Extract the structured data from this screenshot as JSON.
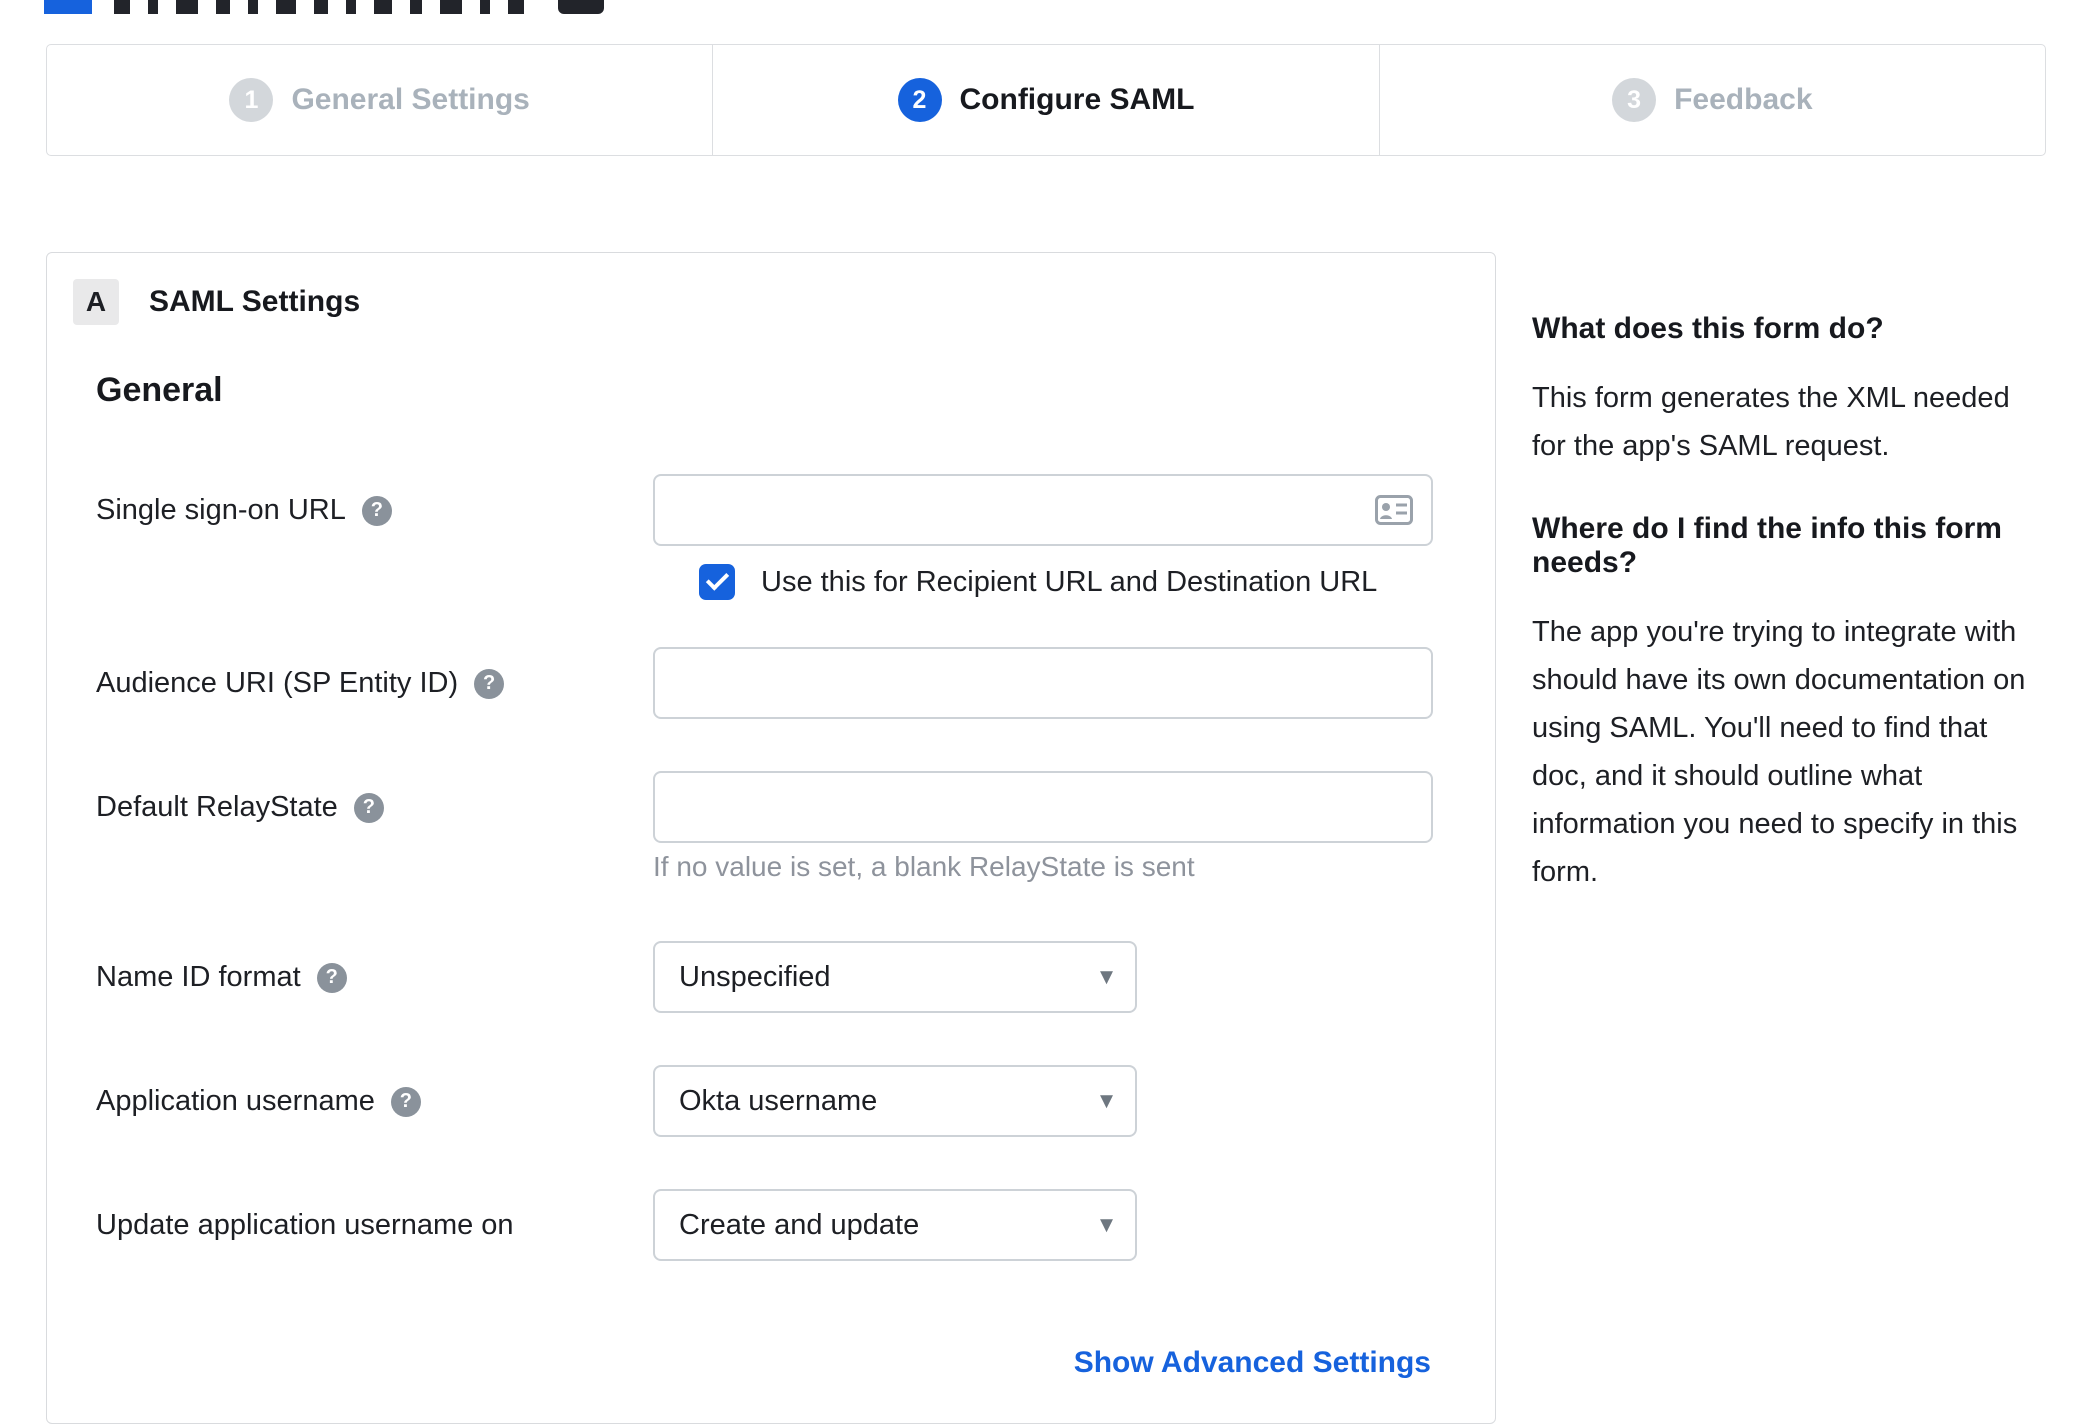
{
  "stepper": {
    "steps": [
      {
        "number": "1",
        "label": "General Settings",
        "state": "inactive"
      },
      {
        "number": "2",
        "label": "Configure SAML",
        "state": "active"
      },
      {
        "number": "3",
        "label": "Feedback",
        "state": "inactive"
      }
    ],
    "active_index": 1
  },
  "panel": {
    "section_badge": "A",
    "section_title": "SAML Settings",
    "group_title": "General",
    "sso": {
      "label": "Single sign-on URL",
      "value": "",
      "checkbox_label": "Use this for Recipient URL and Destination URL",
      "checkbox_checked": true
    },
    "audience": {
      "label": "Audience URI (SP Entity ID)",
      "value": ""
    },
    "relay_state": {
      "label": "Default RelayState",
      "value": "",
      "hint": "If no value is set, a blank RelayState is sent"
    },
    "name_id_format": {
      "label": "Name ID format",
      "value": "Unspecified"
    },
    "app_username": {
      "label": "Application username",
      "value": "Okta username"
    },
    "update_app_username": {
      "label": "Update application username on",
      "value": "Create and update"
    },
    "advanced_link": "Show Advanced Settings"
  },
  "sidebar": {
    "q1": "What does this form do?",
    "a1": "This form generates the XML needed for the app's SAML request.",
    "q2": "Where do I find the info this form needs?",
    "a2": "The app you're trying to integrate with should have its own documentation on using SAML. You'll need to find that doc, and it should outline what information you need to specify in this form."
  },
  "icons": {
    "help": "?",
    "dropdown_arrow": "▾"
  },
  "colors": {
    "accent_blue": "#1662dd",
    "inactive_gray": "#a9b2bb",
    "link_blue": "#1662dd"
  }
}
